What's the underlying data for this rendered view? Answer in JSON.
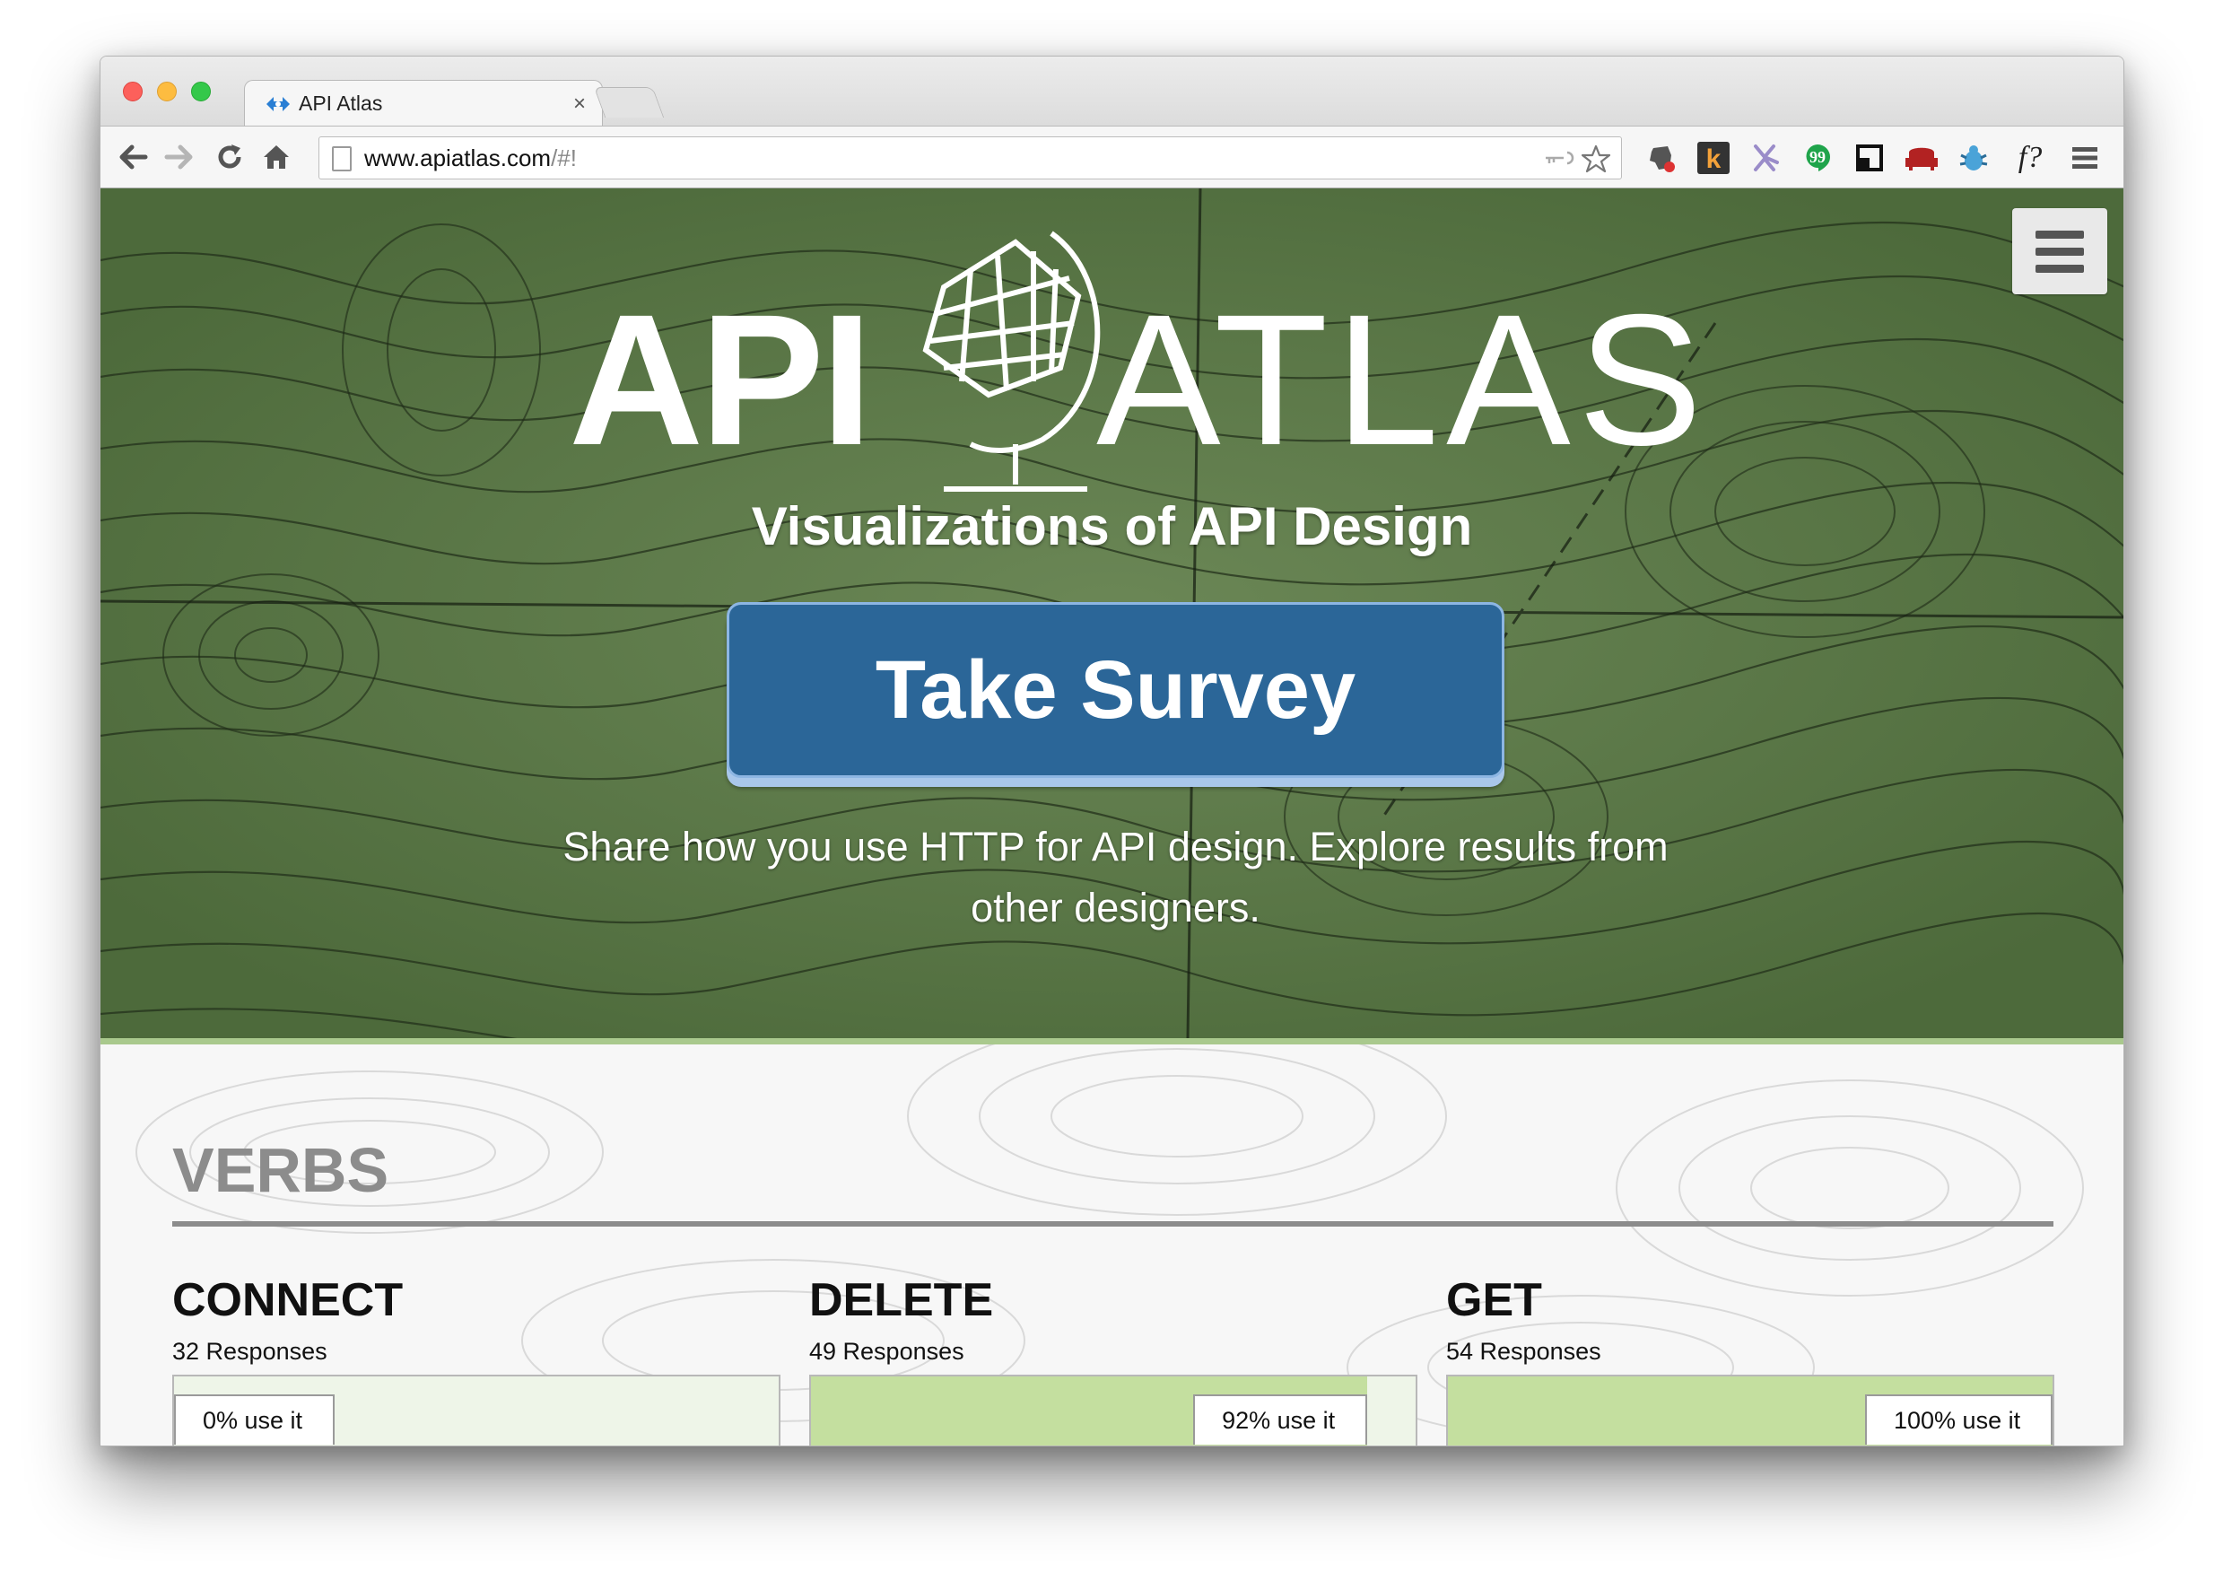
{
  "browser": {
    "tab_title": "API Atlas",
    "tab_close": "×",
    "url_host": "www.apiatlas.com",
    "url_rest": "/#!",
    "colors": {
      "close": "#fc605b",
      "minimize": "#fdbc40",
      "zoom": "#34c84a"
    },
    "extensions": [
      "evernote-icon",
      "k-icon",
      "puzzle-icon",
      "hangouts-icon",
      "window-icon",
      "sofa-icon",
      "bug-icon",
      "font-icon",
      "chrome-menu-icon"
    ],
    "font_ext_text": "f?"
  },
  "hero": {
    "logo_api": "API",
    "logo_atlas": "ATLAS",
    "tagline": "Visualizations of API Design",
    "survey_button": "Take Survey",
    "description": "Share how you use HTTP for API design. Explore results from other designers.",
    "colors": {
      "map_green": "#5d7748",
      "button_blue": "#2b6698",
      "accent_green": "#a9c98d"
    }
  },
  "section": {
    "title": "VERBS"
  },
  "verbs": [
    {
      "name": "CONNECT",
      "responses": "32 Responses",
      "percent": 0,
      "label": "0% use it"
    },
    {
      "name": "DELETE",
      "responses": "49 Responses",
      "percent": 92,
      "label": "92% use it"
    },
    {
      "name": "GET",
      "responses": "54 Responses",
      "percent": 100,
      "label": "100% use it"
    }
  ]
}
